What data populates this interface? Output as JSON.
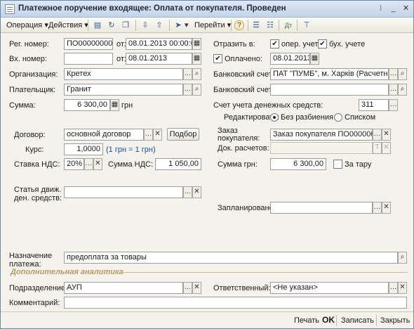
{
  "window": {
    "title": "Платежное поручение входящее: Оплата от покупателя. Проведен"
  },
  "toolbar": {
    "operation": "Операция",
    "actions": "Действия",
    "goto": "Перейти",
    "help": "?"
  },
  "form": {
    "reg_number_label": "Рег. номер:",
    "reg_number": "ПО000000001",
    "from_label": "от:",
    "reg_date": "08.01.2013 00:00:00",
    "in_number_label": "Вх. номер:",
    "in_number": "",
    "in_from_label": "от:",
    "in_date": "08.01.2013",
    "reflect_label": "Отразить в:",
    "oper_label": "опер. учете",
    "buh_label": "бух. учете",
    "paid_label": "Оплачено:",
    "paid_date": "08.01.2013",
    "org_label": "Организация:",
    "org": "Кретех",
    "bank_account_label": "Банковский счет:",
    "bank_account": "ПАТ \"ПУМБ\", м. Харків (Расчетный)",
    "payer_label": "Плательщик:",
    "payer": "Гранит",
    "bank_account2_label": "Банковский счет:",
    "bank_account2": "",
    "sum_label": "Сумма:",
    "sum": "6 300,00",
    "currency": "грн",
    "cash_account_label": "Счет учета денежных средств:",
    "cash_account": "311",
    "edit_label": "Редактировать:",
    "edit_opt1": "Без разбиения",
    "edit_opt2": "Списком",
    "contract_label": "Договор:",
    "contract": "основной договор",
    "select_button": "Подбор",
    "order_label": "Заказ покупателя:",
    "order": "Заказ покупателя ПО000000001",
    "rate_label": "Курс:",
    "rate": "1,0000",
    "rate_note": "(1 грн = 1 грн)",
    "settle_doc_label": "Док. расчетов:",
    "settle_doc": "",
    "vat_rate_label": "Ставка НДС:",
    "vat_rate": "20%",
    "vat_sum_label": "Сумма НДС:",
    "vat_sum": "1 050,00",
    "sum_uah_label": "Сумма грн:",
    "sum_uah": "6 300,00",
    "for_tare_label": "За тару",
    "cashflow_label_1": "Статья движ.",
    "cashflow_label_2": "ден. средств:",
    "cashflow": "",
    "planned_label": "Запланировано:",
    "planned": "",
    "purpose_label_1": "Назначение",
    "purpose_label_2": "платежа:",
    "purpose": "предоплата за товары",
    "analytics_title": "Дополнительная аналитика",
    "dept_label": "Подразделение:",
    "dept": "АУП",
    "responsible_label": "Ответственный:",
    "responsible": "<Не указан>",
    "comment_label": "Комментарий:",
    "comment": ""
  },
  "bottom": {
    "print": "Печать",
    "ok": "OK",
    "save": "Записать",
    "close": "Закрыть"
  }
}
